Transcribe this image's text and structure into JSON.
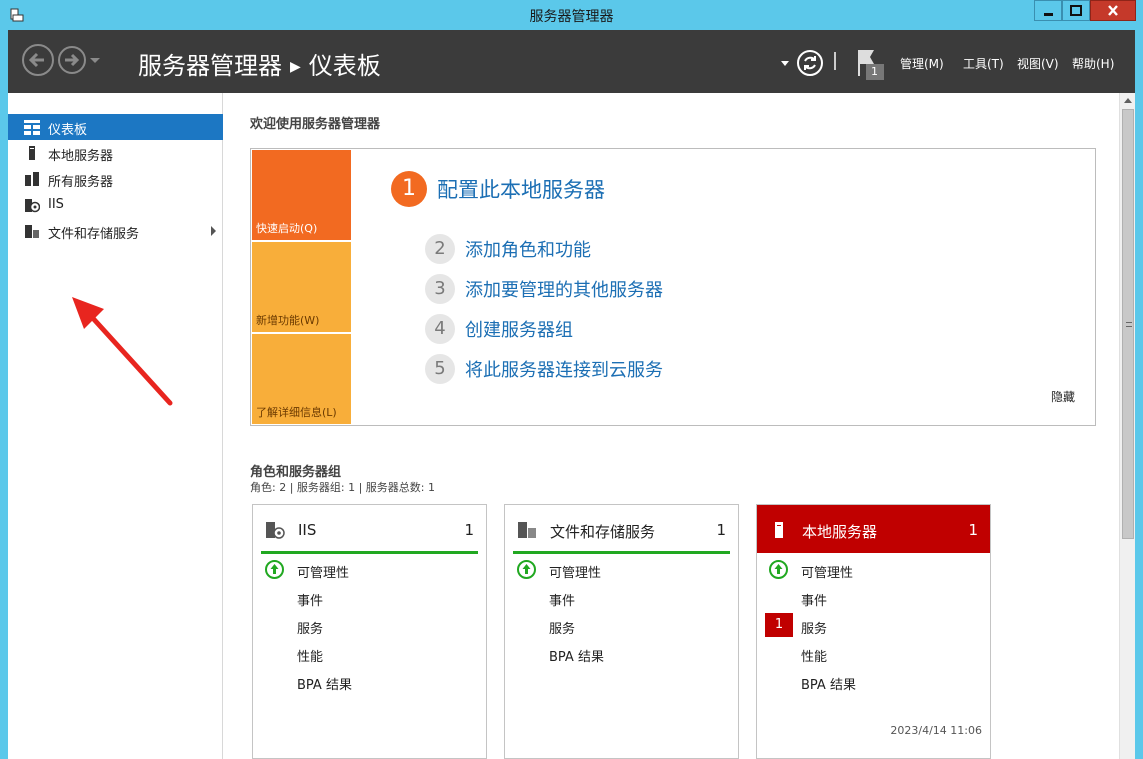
{
  "window": {
    "title": "服务器管理器"
  },
  "header": {
    "breadcrumb_root": "服务器管理器",
    "breadcrumb_page": "仪表板",
    "flag_count": "1",
    "menus": [
      {
        "label": "管理(M)"
      },
      {
        "label": "工具(T)"
      },
      {
        "label": "视图(V)"
      },
      {
        "label": "帮助(H)"
      }
    ]
  },
  "sidebar": {
    "items": [
      {
        "label": "仪表板",
        "icon": "dashboard-icon"
      },
      {
        "label": "本地服务器",
        "icon": "server-icon"
      },
      {
        "label": "所有服务器",
        "icon": "servers-icon"
      },
      {
        "label": "IIS",
        "icon": "iis-icon"
      },
      {
        "label": "文件和存储服务",
        "icon": "file-storage-icon"
      }
    ]
  },
  "welcome": {
    "title": "欢迎使用服务器管理器",
    "tiles": [
      {
        "label": "快速启动(Q)"
      },
      {
        "label": "新增功能(W)"
      },
      {
        "label": "了解详细信息(L)"
      }
    ],
    "steps": [
      {
        "num": "1",
        "text": "配置此本地服务器"
      },
      {
        "num": "2",
        "text": "添加角色和功能"
      },
      {
        "num": "3",
        "text": "添加要管理的其他服务器"
      },
      {
        "num": "4",
        "text": "创建服务器组"
      },
      {
        "num": "5",
        "text": "将此服务器连接到云服务"
      }
    ],
    "hide_label": "隐藏"
  },
  "roles": {
    "title": "角色和服务器组",
    "subtitle": "角色: 2 | 服务器组: 1 | 服务器总数: 1",
    "cards": [
      {
        "title": "IIS",
        "count": "1",
        "rows": [
          "可管理性",
          "事件",
          "服务",
          "性能",
          "BPA 结果"
        ]
      },
      {
        "title": "文件和存储服务",
        "count": "1",
        "rows": [
          "可管理性",
          "事件",
          "服务",
          "性能",
          "BPA 结果"
        ]
      },
      {
        "title": "本地服务器",
        "count": "1",
        "rows": [
          "可管理性",
          "事件",
          "服务",
          "性能",
          "BPA 结果"
        ],
        "service_badge": "1",
        "timestamp": "2023/4/14 11:06"
      }
    ]
  },
  "colors": {
    "titlebar": "#5bc8ea",
    "header": "#3b3b3b",
    "active_nav": "#1c77c3",
    "quick_start": "#f26a21",
    "tile_secondary": "#f8ae3a",
    "ok_green": "#21a821",
    "alert_red": "#c00000"
  }
}
